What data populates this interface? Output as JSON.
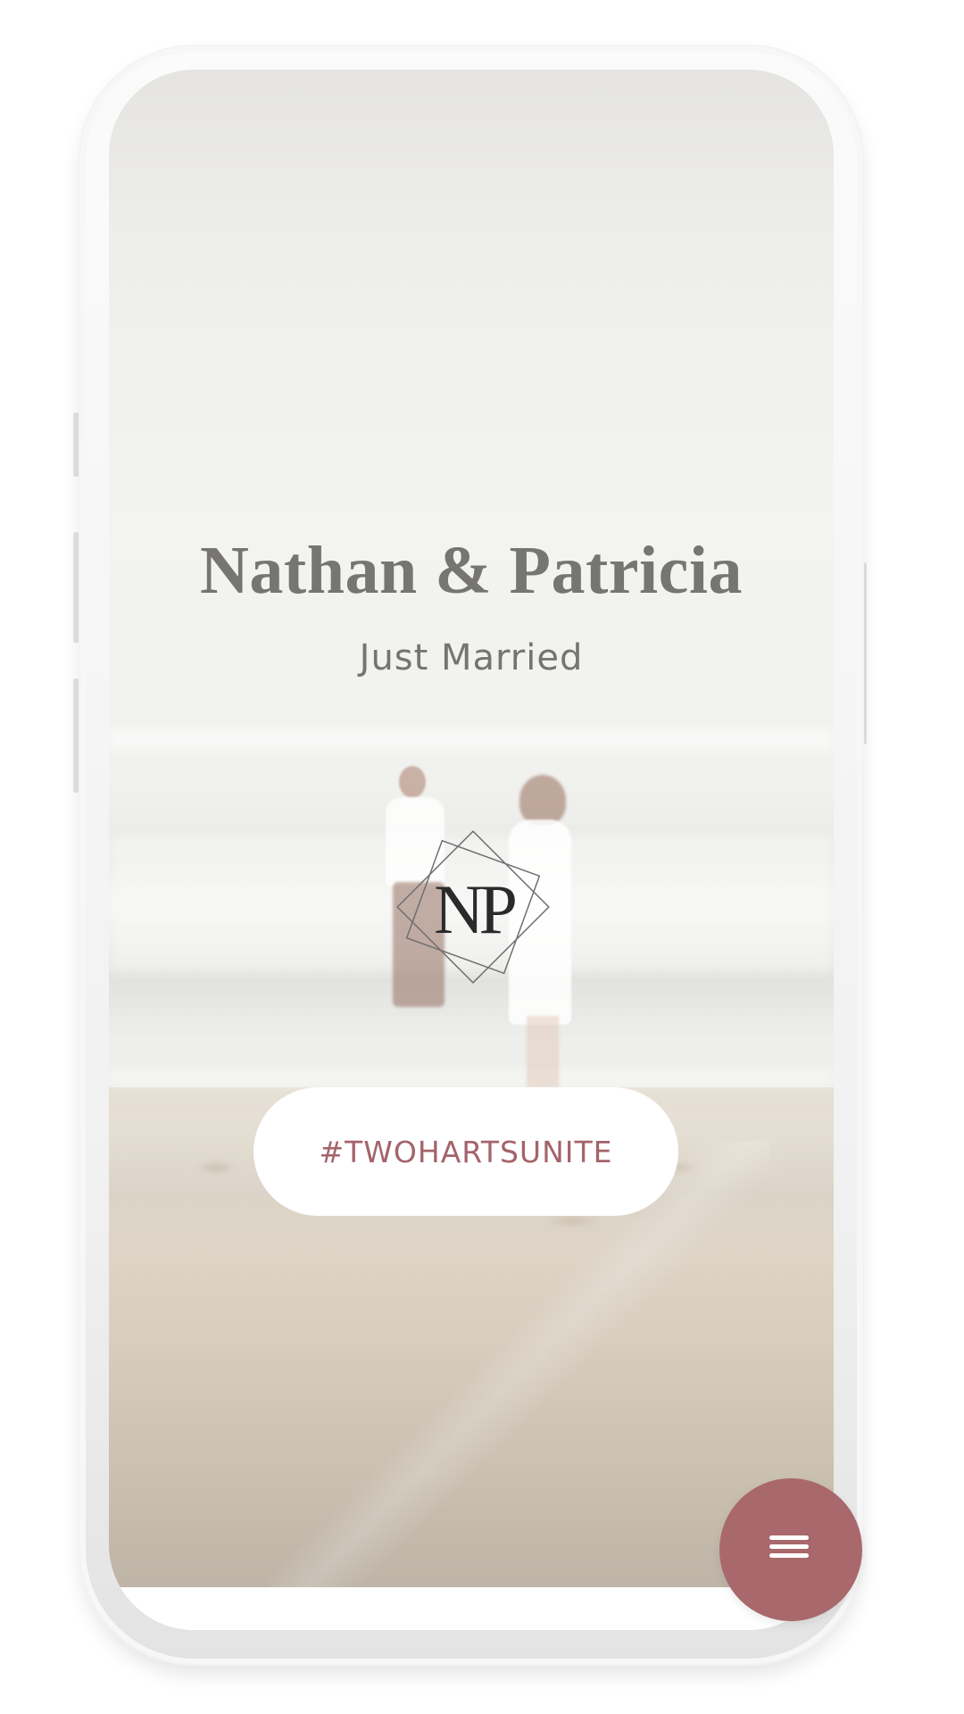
{
  "hero": {
    "title": "Nathan & Patricia",
    "subtitle": "Just Married",
    "monogram": "NP"
  },
  "hashtag_button": {
    "label": "#TWOHARTSUNITE"
  },
  "menu": {
    "icon": "menu-icon"
  },
  "colors": {
    "accent": "#a9686b",
    "hashtag_text": "#a4636a",
    "title_text": "#767573"
  }
}
